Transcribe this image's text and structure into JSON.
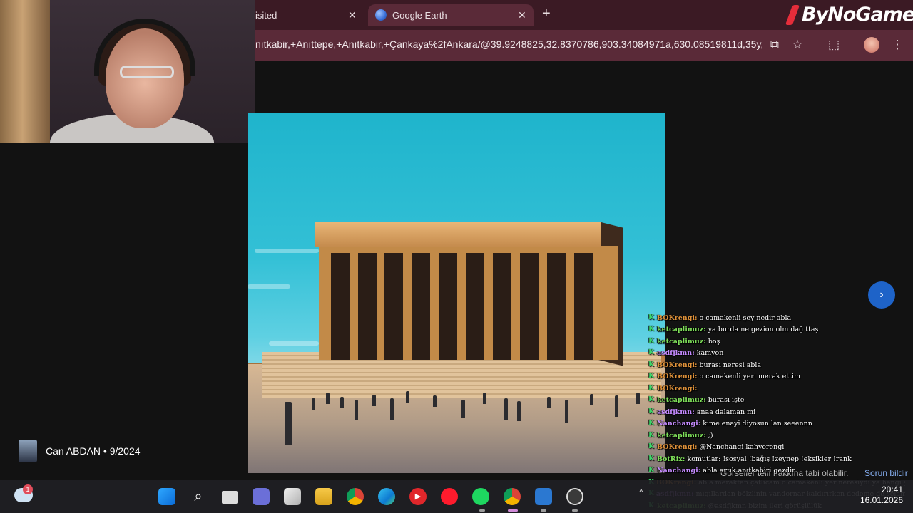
{
  "browser": {
    "tabs": [
      {
        "label": "isited"
      },
      {
        "label": "Google Earth"
      }
    ],
    "url": "nıtkabir,+Anıttepe,+Anıtkabir,+Çankaya%2fAnkara/@39.9248825,32.8370786,903.34084971a,630.08519811d,35y,..."
  },
  "logo": {
    "text": "ByNoGame"
  },
  "credit": {
    "text": "Can ABDAN • 9/2024"
  },
  "notice": {
    "text": "Görseller telif hakkına tabi olabilir.",
    "link": "Sorun bildir"
  },
  "chat": {
    "messages": [
      {
        "user": "BOKrengi:",
        "user_color": "#e0923a",
        "text": "o camakenli şey nedir abla"
      },
      {
        "user": "ketcaplimuz:",
        "user_color": "#7fe05a",
        "text": "ya burda ne gezion olm dağ ttaş"
      },
      {
        "user": "ketcaplimuz:",
        "user_color": "#7fe05a",
        "text": "boş"
      },
      {
        "user": "asdfjkmn:",
        "user_color": "#c58bff",
        "text": "kamyon"
      },
      {
        "user": "BOKrengi:",
        "user_color": "#e0923a",
        "text": "burası neresi abla"
      },
      {
        "user": "BOKrengi:",
        "user_color": "#e0923a",
        "text": "o camakenli yeri merak ettim"
      },
      {
        "user": "BOKrengi:",
        "user_color": "#e0923a",
        "text": ""
      },
      {
        "user": "ketcaplimuz:",
        "user_color": "#7fe05a",
        "text": "burası işte"
      },
      {
        "user": "asdfjkmn:",
        "user_color": "#c58bff",
        "text": "anaa dalaman mi"
      },
      {
        "user": "Nanchangi:",
        "user_color": "#c58bff",
        "text": "kime enayi diyosun lan seeennn"
      },
      {
        "user": "ketcaplimuz:",
        "user_color": "#7fe05a",
        "text": ";)"
      },
      {
        "user": "BOKrengi:",
        "user_color": "#e0923a",
        "text": "@Nanchangi kahverengi"
      },
      {
        "user": "BotRix:",
        "user_color": "#7fe05a",
        "text": "komutlar: !sosyal !bağış !zeynep !eksikler !rank"
      },
      {
        "user": "Nanchangi:",
        "user_color": "#c58bff",
        "text": "abla artık anıtkabiri gezdir"
      },
      {
        "user": "BOKrengi:",
        "user_color": "#e0923a",
        "text": "abla meraktan çatlıcam o camakenli yer neresiydi ya hangi şehir"
      },
      {
        "user": "asdfjkmn:",
        "user_color": "#c58bff",
        "text": "mıgıllardan bölzlinin vandornar kaldırırken dedeme de selam"
      },
      {
        "user": "ketcaplimuz:",
        "user_color": "#7fe05a",
        "text": "@asdfjkmn bizim ileri görüşlülük"
      }
    ]
  },
  "taskbar": {
    "weather_badge": "1",
    "time": "20:41",
    "date": "16.01.2026"
  }
}
